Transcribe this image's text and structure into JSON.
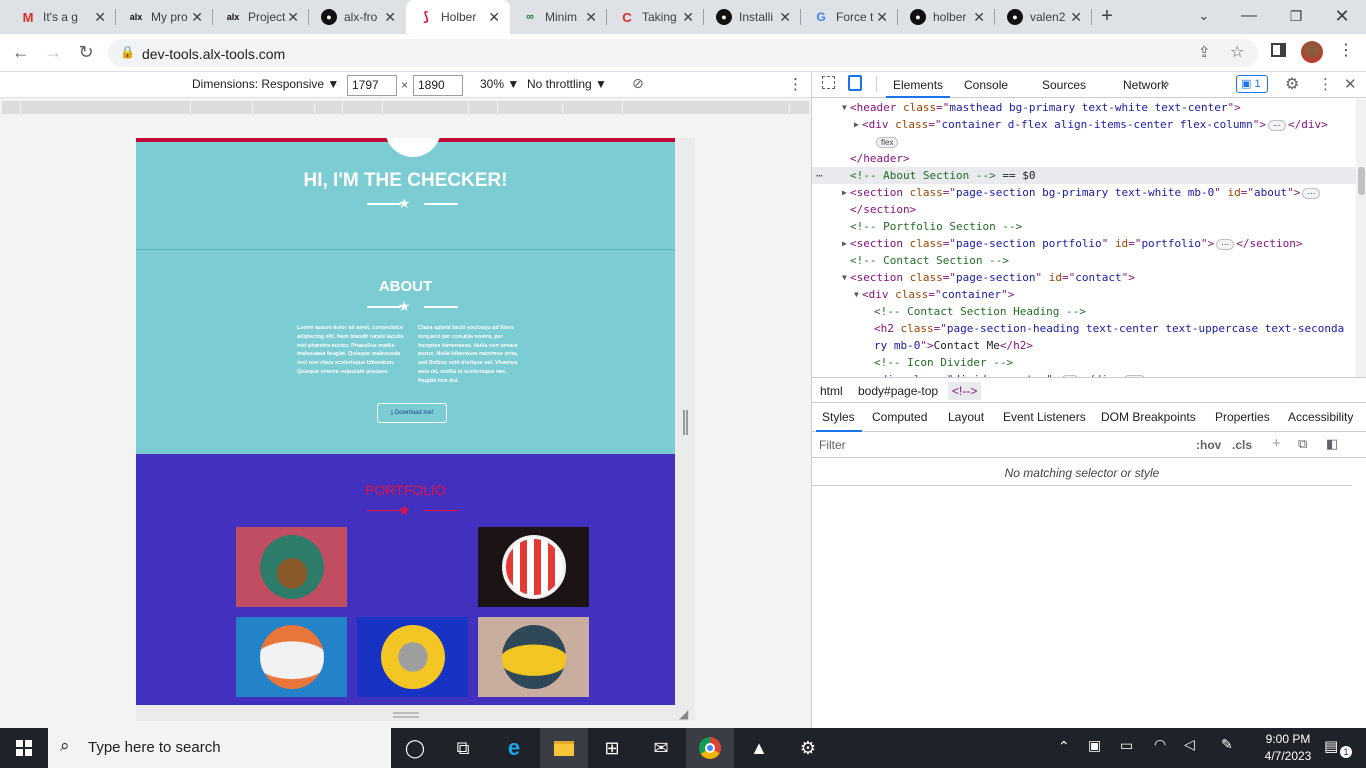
{
  "browser": {
    "tabs": [
      {
        "title": "It's a g",
        "icon": "gmail-icon",
        "active": false
      },
      {
        "title": "My pro",
        "icon": "alx-icon",
        "active": false
      },
      {
        "title": "Project",
        "icon": "alx-icon",
        "active": false
      },
      {
        "title": "alx-fro",
        "icon": "github-icon",
        "active": false
      },
      {
        "title": "Holber",
        "icon": "holberton-icon",
        "active": true
      },
      {
        "title": "Minim",
        "icon": "minim-icon",
        "active": false
      },
      {
        "title": "Taking",
        "icon": "coursera-icon",
        "active": false
      },
      {
        "title": "Installi",
        "icon": "github-icon",
        "active": false
      },
      {
        "title": "Force t",
        "icon": "google-icon",
        "active": false
      },
      {
        "title": "holber",
        "icon": "github-icon",
        "active": false
      },
      {
        "title": "valen2",
        "icon": "github-icon",
        "active": false
      }
    ],
    "new_tab": "+",
    "url": "dev-tools.alx-tools.com"
  },
  "device_toolbar": {
    "dimensions_label": "Dimensions: Responsive ▼",
    "width": "1797",
    "height": "1890",
    "times": "×",
    "zoom": "30% ▼",
    "throttle": "No throttling ▼"
  },
  "site": {
    "hero_title": "HI, I'M THE CHECKER!",
    "about_title": "ABOUT",
    "about_col1": "Lorem ipsum dolor sit amet, consectetur adipiscing elit. Nam blandit turpis iaculis nisl pharetra auctor. Phasellus mattis malesuada feugiat. Quisque malesuada orci non risus scelerisque bibendum. Quisque viverra vulputate posuere.",
    "about_col2": "Class aptent taciti sociosqu ad litora torquent per conubia nostra, per inceptos himenaeos. Nulla non ornare purus. Nulla bibendum maximus urna, sed finibus velit tristique vel. Vivamus ante mi, mollis et scelerisque nec, feugiat non dui.",
    "download_label": "⤓ Download me!",
    "portfolio_title": "PORTFOLIO"
  },
  "devtools": {
    "tabs": [
      "Elements",
      "Console",
      "Sources",
      "Network",
      "»"
    ],
    "issues_count": "1",
    "dom_lines": [
      {
        "indent": 0,
        "tri": "▼",
        "parts": [
          [
            "tg",
            "<header "
          ],
          [
            "at",
            "class"
          ],
          [
            "tg",
            "=\""
          ],
          [
            "av",
            "masthead bg-primary text-white text-center"
          ],
          [
            "tg",
            "\">"
          ]
        ]
      },
      {
        "indent": 1,
        "tri": "▶",
        "parts": [
          [
            "tg",
            "<div "
          ],
          [
            "at",
            "class"
          ],
          [
            "tg",
            "=\""
          ],
          [
            "av",
            "container d-flex align-items-center flex-column"
          ],
          [
            "tg",
            "\">"
          ],
          [
            "chip",
            "⋯"
          ],
          [
            "tg",
            "</div>"
          ]
        ]
      },
      {
        "indent": 2,
        "tri": "",
        "parts": [
          [
            "chip",
            "flex"
          ]
        ]
      },
      {
        "indent": 0,
        "tri": "",
        "parts": [
          [
            "tg",
            "</header>"
          ]
        ]
      },
      {
        "indent": 0,
        "tri": "",
        "sel": true,
        "parts": [
          [
            "cm",
            "<!-- About Section -->"
          ],
          [
            "tx",
            " == $0"
          ]
        ]
      },
      {
        "indent": 0,
        "tri": "▶",
        "parts": [
          [
            "tg",
            "<section "
          ],
          [
            "at",
            "class"
          ],
          [
            "tg",
            "=\""
          ],
          [
            "av",
            "page-section bg-primary text-white mb-0"
          ],
          [
            "tg",
            "\" "
          ],
          [
            "at",
            "id"
          ],
          [
            "tg",
            "=\""
          ],
          [
            "av",
            "about"
          ],
          [
            "tg",
            "\">"
          ],
          [
            "chip",
            "⋯"
          ]
        ]
      },
      {
        "indent": 0,
        "tri": "",
        "parts": [
          [
            "tg",
            "</section>"
          ]
        ]
      },
      {
        "indent": 0,
        "tri": "",
        "parts": [
          [
            "cm",
            "<!-- Portfolio Section -->"
          ]
        ]
      },
      {
        "indent": 0,
        "tri": "▶",
        "parts": [
          [
            "tg",
            "<section "
          ],
          [
            "at",
            "class"
          ],
          [
            "tg",
            "=\""
          ],
          [
            "av",
            "page-section portfolio"
          ],
          [
            "tg",
            "\" "
          ],
          [
            "at",
            "id"
          ],
          [
            "tg",
            "=\""
          ],
          [
            "av",
            "portfolio"
          ],
          [
            "tg",
            "\">"
          ],
          [
            "chip",
            "⋯"
          ],
          [
            "tg",
            "</section>"
          ]
        ]
      },
      {
        "indent": 0,
        "tri": "",
        "parts": [
          [
            "cm",
            "<!-- Contact Section -->"
          ]
        ]
      },
      {
        "indent": 0,
        "tri": "▼",
        "parts": [
          [
            "tg",
            "<section "
          ],
          [
            "at",
            "class"
          ],
          [
            "tg",
            "=\""
          ],
          [
            "av",
            "page-section"
          ],
          [
            "tg",
            "\" "
          ],
          [
            "at",
            "id"
          ],
          [
            "tg",
            "=\""
          ],
          [
            "av",
            "contact"
          ],
          [
            "tg",
            "\">"
          ]
        ]
      },
      {
        "indent": 1,
        "tri": "▼",
        "parts": [
          [
            "tg",
            "<div "
          ],
          [
            "at",
            "class"
          ],
          [
            "tg",
            "=\""
          ],
          [
            "av",
            "container"
          ],
          [
            "tg",
            "\">"
          ]
        ]
      },
      {
        "indent": 2,
        "tri": "",
        "parts": [
          [
            "cm",
            "<!-- Contact Section Heading -->"
          ]
        ]
      },
      {
        "indent": 2,
        "tri": "",
        "parts": [
          [
            "tg",
            "<h2 "
          ],
          [
            "at",
            "class"
          ],
          [
            "tg",
            "=\""
          ],
          [
            "av",
            "page-section-heading text-center text-uppercase text-seconda"
          ]
        ]
      },
      {
        "indent": 2,
        "tri": "",
        "parts": [
          [
            "av",
            "ry mb-0"
          ],
          [
            "tg",
            "\">"
          ],
          [
            "tx",
            "Contact Me"
          ],
          [
            "tg",
            "</h2>"
          ]
        ]
      },
      {
        "indent": 2,
        "tri": "",
        "parts": [
          [
            "cm",
            "<!-- Icon Divider -->"
          ]
        ]
      },
      {
        "indent": 2,
        "tri": "▶",
        "parts": [
          [
            "tg",
            "<div "
          ],
          [
            "at",
            "class"
          ],
          [
            "tg",
            "=\""
          ],
          [
            "av",
            "divider-custom"
          ],
          [
            "tg",
            "\">"
          ],
          [
            "chip",
            "⋯"
          ],
          [
            "tg",
            "</div>"
          ],
          [
            "chip",
            "flex"
          ]
        ]
      }
    ],
    "breadcrumbs": [
      "html",
      "body#page-top",
      "<!-->"
    ],
    "styles_tabs": [
      "Styles",
      "Computed",
      "Layout",
      "Event Listeners",
      "DOM Breakpoints",
      "Properties",
      "Accessibility"
    ],
    "filter_placeholder": "Filter",
    "hov": ":hov",
    "cls": ".cls",
    "no_match": "No matching selector or style"
  },
  "taskbar": {
    "search_placeholder": "Type here to search",
    "time": "9:00 PM",
    "date": "4/7/2023",
    "notifications": "1"
  }
}
